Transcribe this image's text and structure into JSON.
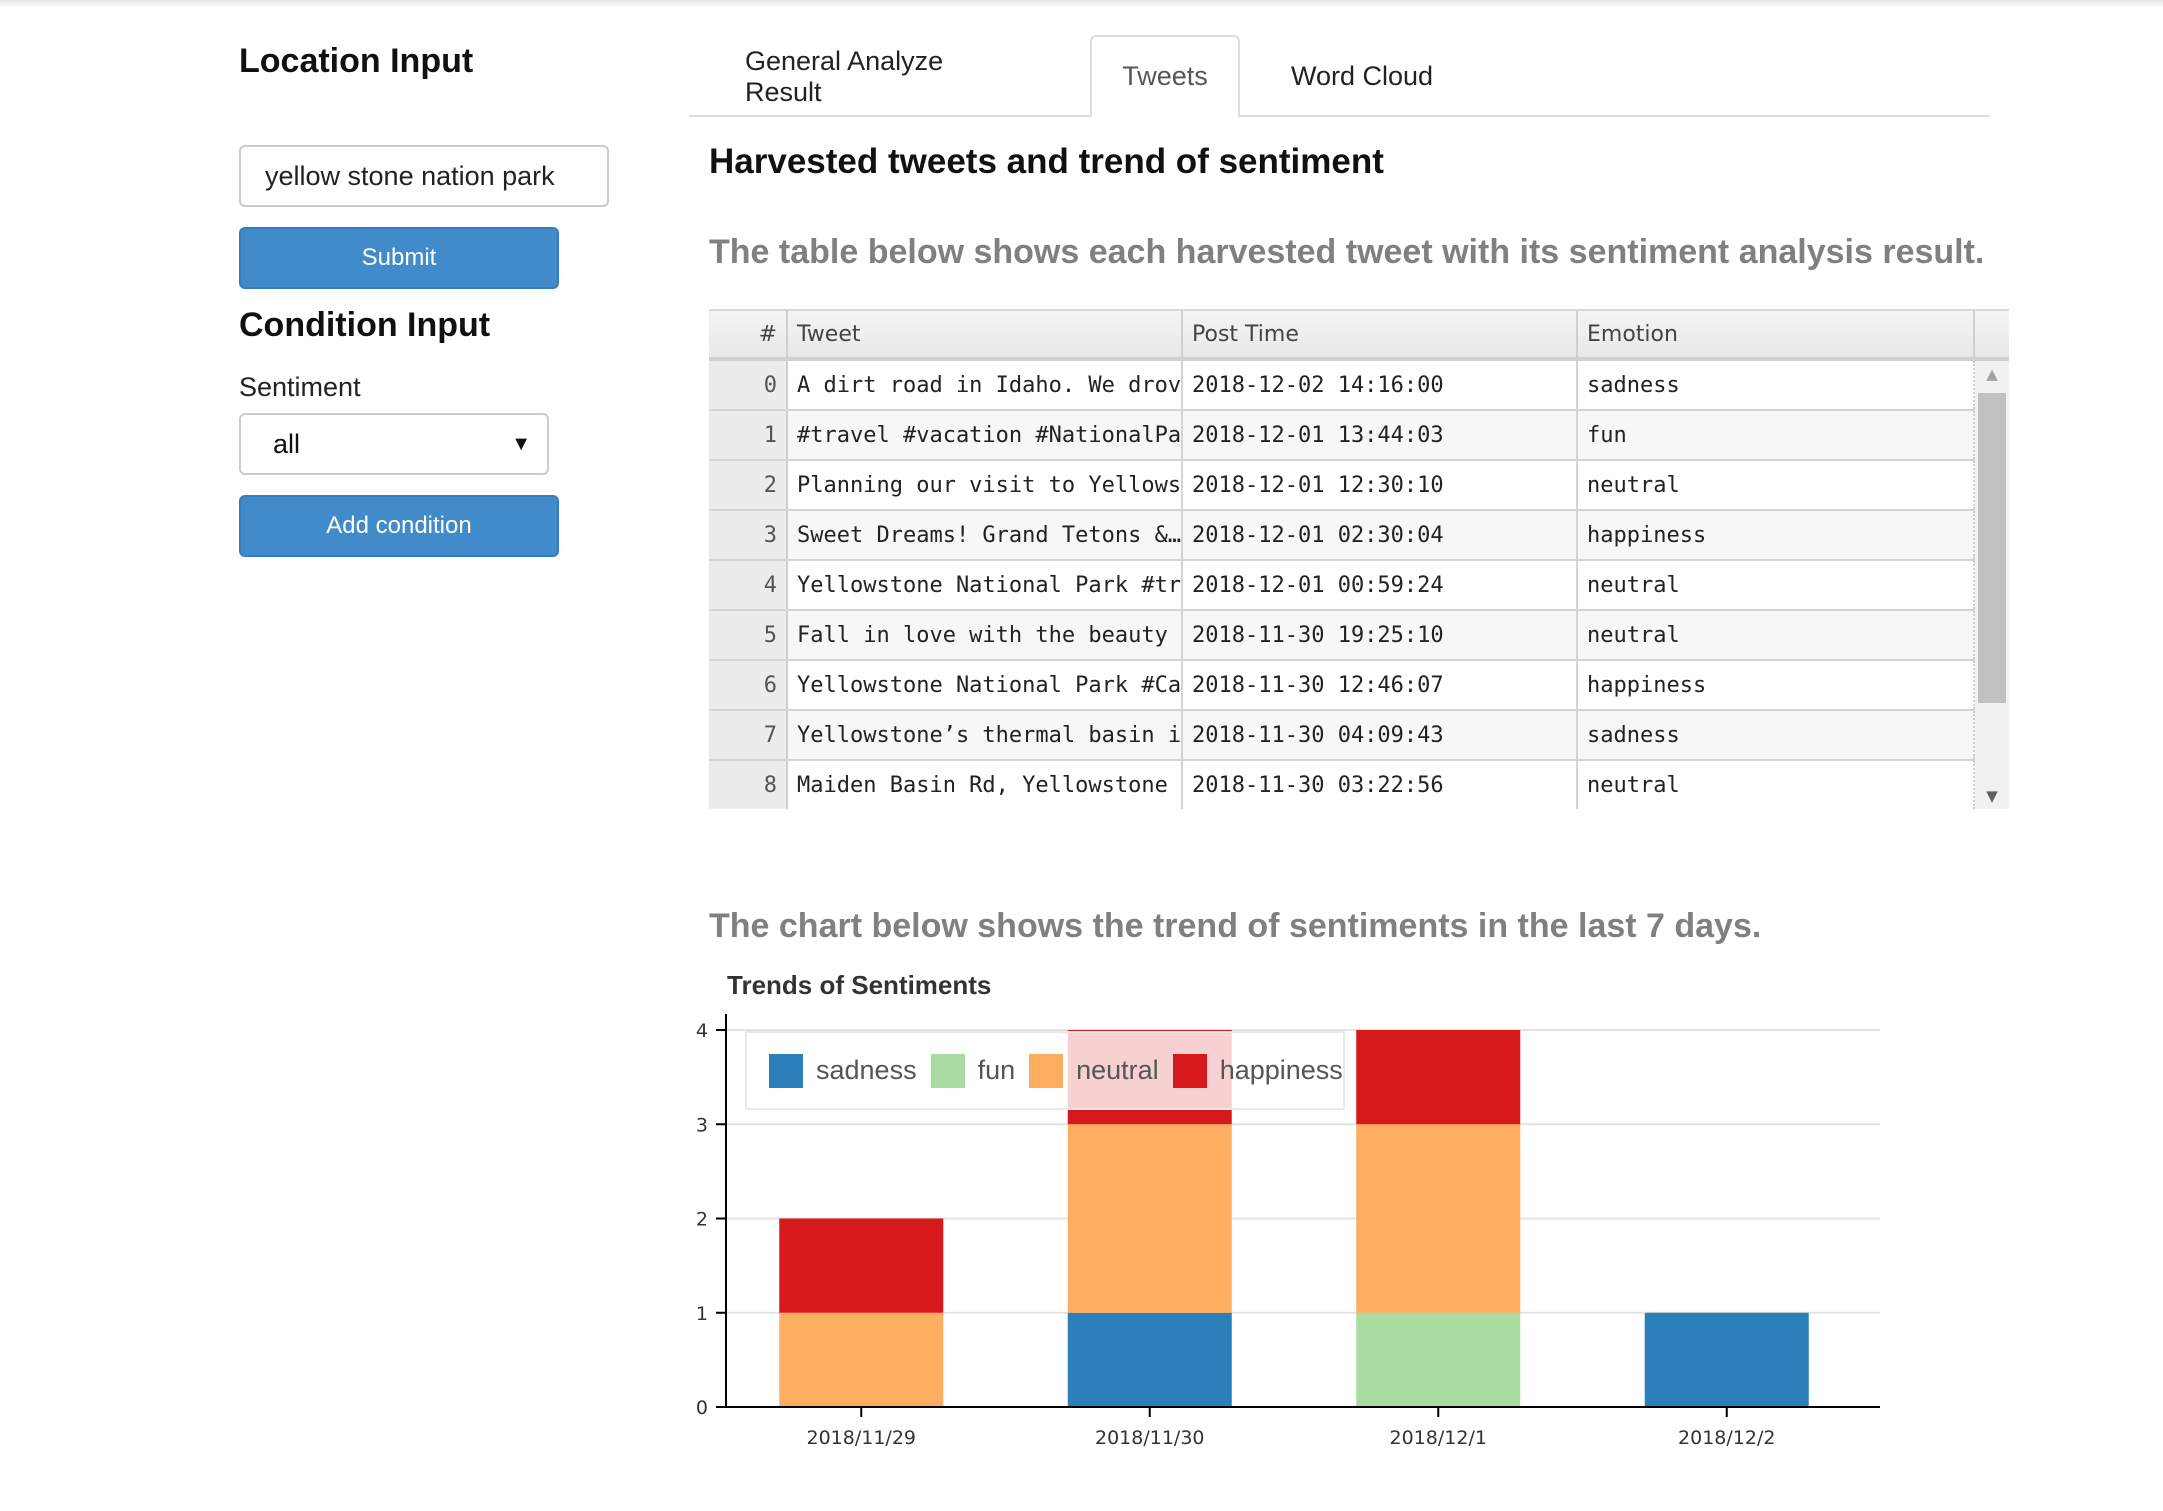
{
  "sidebar": {
    "location_heading": "Location Input",
    "location_value": "yellow stone nation park",
    "submit_label": "Submit",
    "condition_heading": "Condition Input",
    "sentiment_label": "Sentiment",
    "sentiment_selected": "all",
    "add_condition_label": "Add condition"
  },
  "tabs": [
    {
      "label": "General Analyze Result",
      "active": false
    },
    {
      "label": "Tweets",
      "active": true
    },
    {
      "label": "Word Cloud",
      "active": false
    }
  ],
  "main": {
    "title": "Harvested tweets and trend of sentiment",
    "table_caption": "The table below shows each harvested tweet with its sentiment analysis result.",
    "chart_caption": "The chart below shows the trend of sentiments in the last 7 days."
  },
  "table": {
    "columns": [
      "#",
      "Tweet",
      "Post Time",
      "Emotion"
    ],
    "rows": [
      [
        "0",
        "A dirt road in Idaho. We drove t…",
        "2018-12-02 14:16:00",
        "sadness"
      ],
      [
        "1",
        "#travel #vacation #NationalPar…",
        "2018-12-01 13:44:03",
        "fun"
      ],
      [
        "2",
        "Planning our visit to Yellowston…",
        "2018-12-01 12:30:10",
        "neutral"
      ],
      [
        "3",
        "Sweet Dreams! Grand Tetons &…",
        "2018-12-01 02:30:04",
        "happiness"
      ],
      [
        "4",
        "Yellowstone National Park #trav…",
        "2018-12-01 00:59:24",
        "neutral"
      ],
      [
        "5",
        "Fall in love with the beauty of n…",
        "2018-11-30 19:25:10",
        "neutral"
      ],
      [
        "6",
        "Yellowstone National Park #Ca…",
        "2018-11-30 12:46:07",
        "happiness"
      ],
      [
        "7",
        "Yellowstone’s thermal basin in S…",
        "2018-11-30 04:09:43",
        "sadness"
      ],
      [
        "8",
        "Maiden Basin Rd, Yellowstone N…",
        "2018-11-30 03:22:56",
        "neutral"
      ]
    ]
  },
  "scroll_icons": {
    "up": "scroll-up-arrow-icon",
    "down": "scroll-down-arrow-icon"
  },
  "chart_data": {
    "type": "bar",
    "stacked": true,
    "title": "Trends of Sentiments",
    "categories": [
      "2018/11/29",
      "2018/11/30",
      "2018/12/1",
      "2018/12/2"
    ],
    "series": [
      {
        "name": "sadness",
        "color": "#2c7fb8",
        "values": [
          0,
          1,
          0,
          1
        ]
      },
      {
        "name": "fun",
        "color": "#a8dca0",
        "values": [
          0,
          0,
          1,
          0
        ]
      },
      {
        "name": "neutral",
        "color": "#fdae61",
        "values": [
          1,
          2,
          2,
          0
        ]
      },
      {
        "name": "happiness",
        "color": "#d7191c",
        "values": [
          1,
          1,
          1,
          0
        ]
      }
    ],
    "ylim": [
      0,
      4
    ],
    "yticks": [
      0,
      1,
      2,
      3,
      4
    ],
    "grid": true,
    "legend_position": "top-left"
  }
}
